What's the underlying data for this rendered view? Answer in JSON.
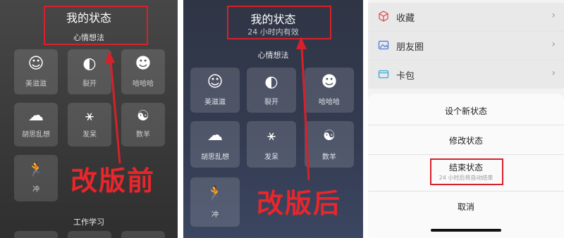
{
  "before": {
    "title": "我的状态",
    "section1": "心情想法",
    "tiles": [
      {
        "icon": "smile-icon",
        "glyph": "☺",
        "label": "美滋滋"
      },
      {
        "icon": "split-face-icon",
        "glyph": "◐",
        "label": "裂开"
      },
      {
        "icon": "laugh-icon",
        "glyph": "☻",
        "label": "哈哈哈"
      },
      {
        "icon": "thought-cloud-icon",
        "glyph": "☁",
        "label": "胡思乱想"
      },
      {
        "icon": "daze-icon",
        "glyph": "⚹",
        "label": "发呆"
      },
      {
        "icon": "sheep-icon",
        "glyph": "☯",
        "label": "数羊"
      },
      {
        "icon": "run-icon",
        "glyph": "🏃",
        "label": "冲"
      }
    ],
    "section2": "工作学习",
    "caption": "改版前"
  },
  "after": {
    "title": "我的状态",
    "subtitle": "24 小时内有效",
    "section1": "心情想法",
    "tiles": [
      {
        "icon": "smile-icon",
        "glyph": "☺",
        "label": "美滋滋"
      },
      {
        "icon": "split-face-icon",
        "glyph": "◐",
        "label": "裂开"
      },
      {
        "icon": "laugh-icon",
        "glyph": "☻",
        "label": "哈哈哈"
      },
      {
        "icon": "thought-cloud-icon",
        "glyph": "☁",
        "label": "胡思乱想"
      },
      {
        "icon": "daze-icon",
        "glyph": "⚹",
        "label": "发呆"
      },
      {
        "icon": "sheep-icon",
        "glyph": "☯",
        "label": "数羊"
      },
      {
        "icon": "run-icon",
        "glyph": "🏃",
        "label": "冲"
      }
    ],
    "caption": "改版后"
  },
  "menu": {
    "items": [
      {
        "icon": "cube-icon",
        "label": "收藏"
      },
      {
        "icon": "image-icon",
        "label": "朋友圈"
      },
      {
        "icon": "wallet-icon",
        "label": "卡包"
      }
    ],
    "options": {
      "set_new": "设个新状态",
      "modify": "修改状态",
      "end": "结束状态",
      "end_note": "24 小时后将自动结束",
      "cancel": "取消"
    }
  },
  "colors": {
    "accent_red": "#d8202a",
    "caption_red": "#e8262c"
  }
}
